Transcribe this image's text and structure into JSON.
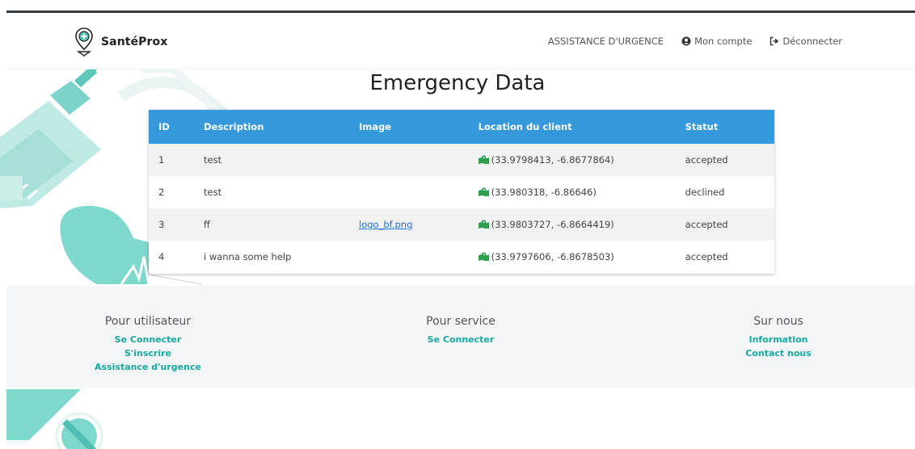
{
  "brand": {
    "name": "SantéProx"
  },
  "nav": {
    "emergency": "ASSISTANCE D'URGENCE",
    "account": "Mon compte",
    "logout": "Déconnecter"
  },
  "page": {
    "title": "Emergency Data"
  },
  "table": {
    "headers": [
      "ID",
      "Description",
      "Image",
      "Location du client",
      "Statut"
    ],
    "rows": [
      {
        "id": "1",
        "description": "test",
        "image": "",
        "location": "(33.9798413, -6.8677864)",
        "status": "accepted"
      },
      {
        "id": "2",
        "description": "test",
        "image": "",
        "location": "(33.980318, -6.86646)",
        "status": "declined"
      },
      {
        "id": "3",
        "description": "ff",
        "image": "logo_bf.png",
        "location": "(33.9803727, -6.8664419)",
        "status": "accepted"
      },
      {
        "id": "4",
        "description": "i wanna some help",
        "image": "",
        "location": "(33.9797606, -6.8678503)",
        "status": "accepted"
      }
    ]
  },
  "footer": {
    "users": {
      "title": "Pour utilisateur",
      "links": [
        "Se Connecter",
        "S'inscrire",
        "Assistance d'urgence"
      ]
    },
    "service": {
      "title": "Pour service",
      "links": [
        "Se Connecter"
      ]
    },
    "about": {
      "title": "Sur nous",
      "links": [
        "Information",
        "Contact nous"
      ]
    }
  },
  "colors": {
    "accent": "#3498db",
    "teal": "#16a8a1",
    "map_icon": "#2e9e4f"
  },
  "icons": {
    "brand": "location-pin-plus-icon",
    "account": "user-circle-icon",
    "logout": "sign-out-icon",
    "location": "map-marked-icon"
  }
}
